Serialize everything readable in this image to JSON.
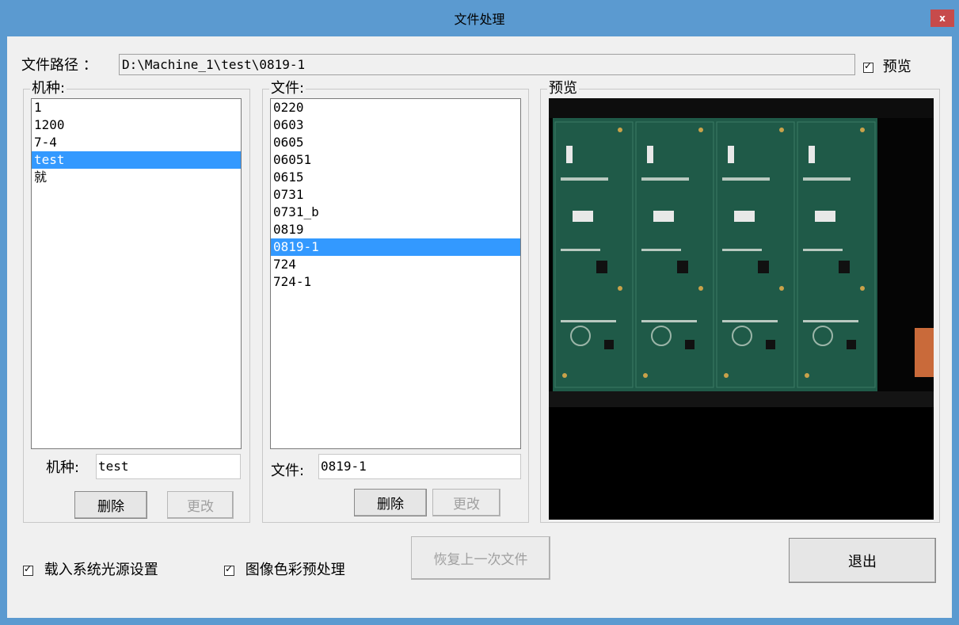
{
  "window": {
    "title": "文件处理",
    "close_label": "x"
  },
  "path": {
    "label": "文件路径 ：",
    "value": "D:\\Machine_1\\test\\0819-1"
  },
  "preview_toggle": {
    "label": "预览",
    "checked": true
  },
  "machine_group": {
    "title": "机种:",
    "items": [
      "1",
      "1200",
      "7-4",
      "test",
      "就"
    ],
    "selected_index": 3,
    "field_label": "机种:",
    "field_value": "test",
    "delete_label": "删除",
    "modify_label": "更改"
  },
  "file_group": {
    "title": "文件:",
    "items": [
      "0220",
      "0603",
      "0605",
      "06051",
      "0615",
      "0731",
      "0731_b",
      "0819",
      "0819-1",
      "724",
      "724-1"
    ],
    "selected_index": 8,
    "field_label": "文件:",
    "field_value": "0819-1",
    "delete_label": "删除",
    "modify_label": "更改"
  },
  "preview_group": {
    "title": "预览",
    "image_description_icon": "pcb-board-image"
  },
  "options": {
    "load_light_label": "载入系统光源设置",
    "load_light_checked": true,
    "color_preprocess_label": "图像色彩预处理",
    "color_preprocess_checked": true
  },
  "buttons": {
    "restore_label": "恢复上一次文件",
    "exit_label": "退出"
  },
  "colors": {
    "titlebar": "#5b9ad0",
    "selection": "#3399ff",
    "close": "#c74b4b",
    "pcb_green": "#1f5a48"
  }
}
